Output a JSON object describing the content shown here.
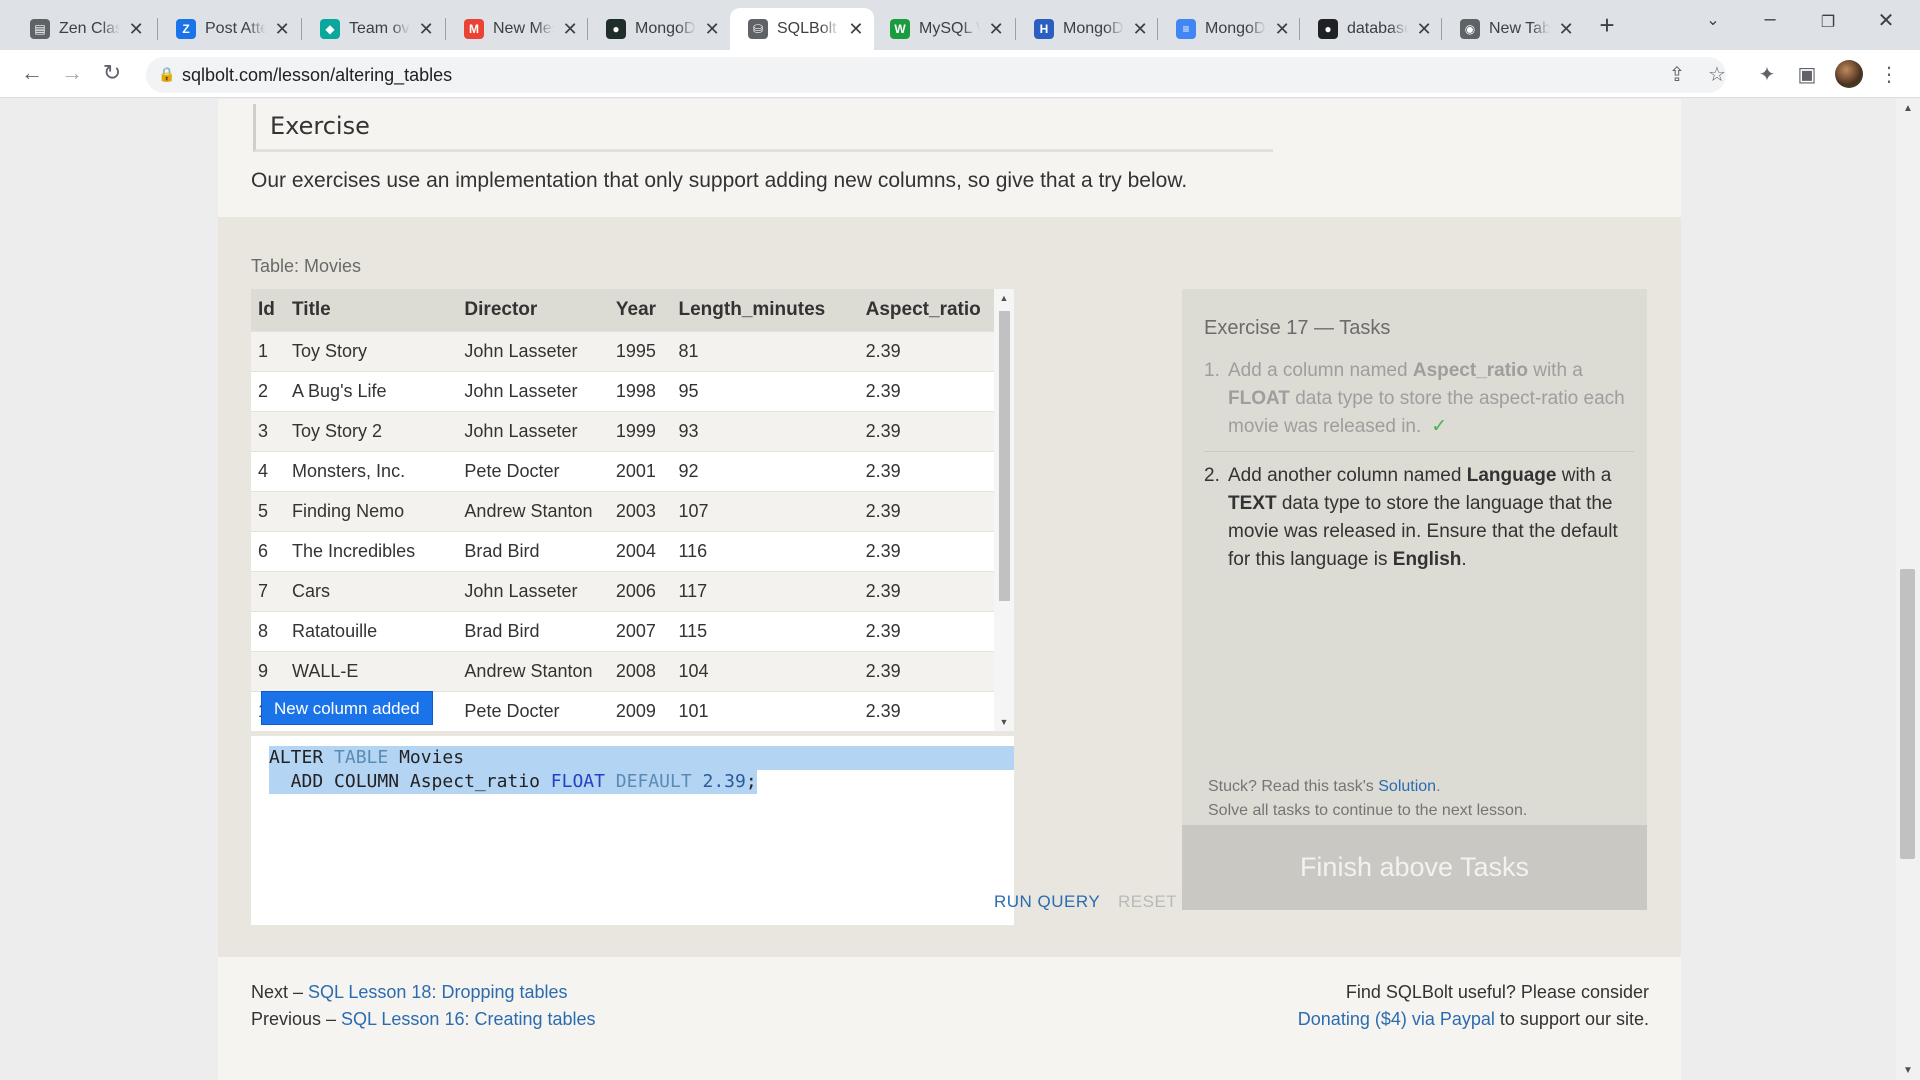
{
  "browser": {
    "tabs": [
      {
        "label": "Zen Class",
        "icon": "zen-class-icon",
        "color": "#5f6368"
      },
      {
        "label": "Post Attendance",
        "icon": "z-icon",
        "color": "#1a73e8"
      },
      {
        "label": "Team overview",
        "icon": "diamond-icon",
        "color": "#0aa89c"
      },
      {
        "label": "New Message",
        "icon": "gmail-icon",
        "color": "#ea4335"
      },
      {
        "label": "MongoDB",
        "icon": "mongodb-icon",
        "color": "#1f2d2b"
      },
      {
        "label": "SQLBolt - ",
        "icon": "database-icon",
        "color": "#5f6368"
      },
      {
        "label": "MySQL Workbench",
        "icon": "w-icon",
        "color": "#1a9c3e"
      },
      {
        "label": "MongoDB",
        "icon": "hashnode-icon",
        "color": "#2b5fbf"
      },
      {
        "label": "MongoDB",
        "icon": "doc-icon",
        "color": "#4285f4"
      },
      {
        "label": "database",
        "icon": "github-icon",
        "color": "#202124"
      },
      {
        "label": "New Tab",
        "icon": "chrome-icon",
        "color": "#5f6368"
      }
    ],
    "active_tab": 5,
    "url": "sqlbolt.com/lesson/altering_tables"
  },
  "exercise": {
    "heading": "Exercise",
    "intro": "Our exercises use an implementation that only support adding new columns, so give that a try below.",
    "table_caption": "Table: Movies",
    "columns": [
      "Id",
      "Title",
      "Director",
      "Year",
      "Length_minutes",
      "Aspect_ratio"
    ],
    "rows": [
      [
        "1",
        "Toy Story",
        "John Lasseter",
        "1995",
        "81",
        "2.39"
      ],
      [
        "2",
        "A Bug's Life",
        "John Lasseter",
        "1998",
        "95",
        "2.39"
      ],
      [
        "3",
        "Toy Story 2",
        "John Lasseter",
        "1999",
        "93",
        "2.39"
      ],
      [
        "4",
        "Monsters, Inc.",
        "Pete Docter",
        "2001",
        "92",
        "2.39"
      ],
      [
        "5",
        "Finding Nemo",
        "Andrew Stanton",
        "2003",
        "107",
        "2.39"
      ],
      [
        "6",
        "The Incredibles",
        "Brad Bird",
        "2004",
        "116",
        "2.39"
      ],
      [
        "7",
        "Cars",
        "John Lasseter",
        "2006",
        "117",
        "2.39"
      ],
      [
        "8",
        "Ratatouille",
        "Brad Bird",
        "2007",
        "115",
        "2.39"
      ],
      [
        "9",
        "WALL-E",
        "Andrew Stanton",
        "2008",
        "104",
        "2.39"
      ],
      [
        "10",
        "",
        "Pete Docter",
        "2009",
        "101",
        "2.39"
      ]
    ],
    "tooltip": "New column added",
    "query": {
      "line1_kw1": "ALTER",
      "line1_kw2": "TABLE",
      "line1_rest": "Movies",
      "line2_a": "  ADD COLUMN Aspect_ratio ",
      "line2_type": "FLOAT",
      "line2_default": "DEFAULT",
      "line2_value": "2.39",
      "line2_end": ";"
    },
    "run_label": "RUN QUERY",
    "reset_label": "RESET"
  },
  "tasks": {
    "title": "Exercise 17 — Tasks",
    "items": [
      {
        "num": "1.",
        "parts": [
          "Add a column named ",
          "Aspect_ratio",
          " with a ",
          "FLOAT",
          " data type to store the aspect-ratio each movie was released in."
        ],
        "done": true,
        "check": "✓"
      },
      {
        "num": "2.",
        "parts": [
          "Add another column named ",
          "Language",
          " with a ",
          "TEXT",
          " data type to store the language that the movie was released in. Ensure that the default for this language is ",
          "English",
          "."
        ],
        "done": false
      }
    ],
    "stuck_prefix": "Stuck? Read this task's ",
    "solution_link": "Solution",
    "stuck_suffix": ".",
    "solve_all": "Solve all tasks to continue to the next lesson.",
    "finish_label": "Finish above Tasks"
  },
  "footer": {
    "next_prefix": "Next – ",
    "next_link": "SQL Lesson 18: Dropping tables",
    "prev_prefix": "Previous – ",
    "prev_link": "SQL Lesson 16: Creating tables",
    "donate_line1": "Find SQLBolt useful? Please consider",
    "donate_link": "Donating ($4) via Paypal",
    "donate_suffix": " to support our site."
  }
}
